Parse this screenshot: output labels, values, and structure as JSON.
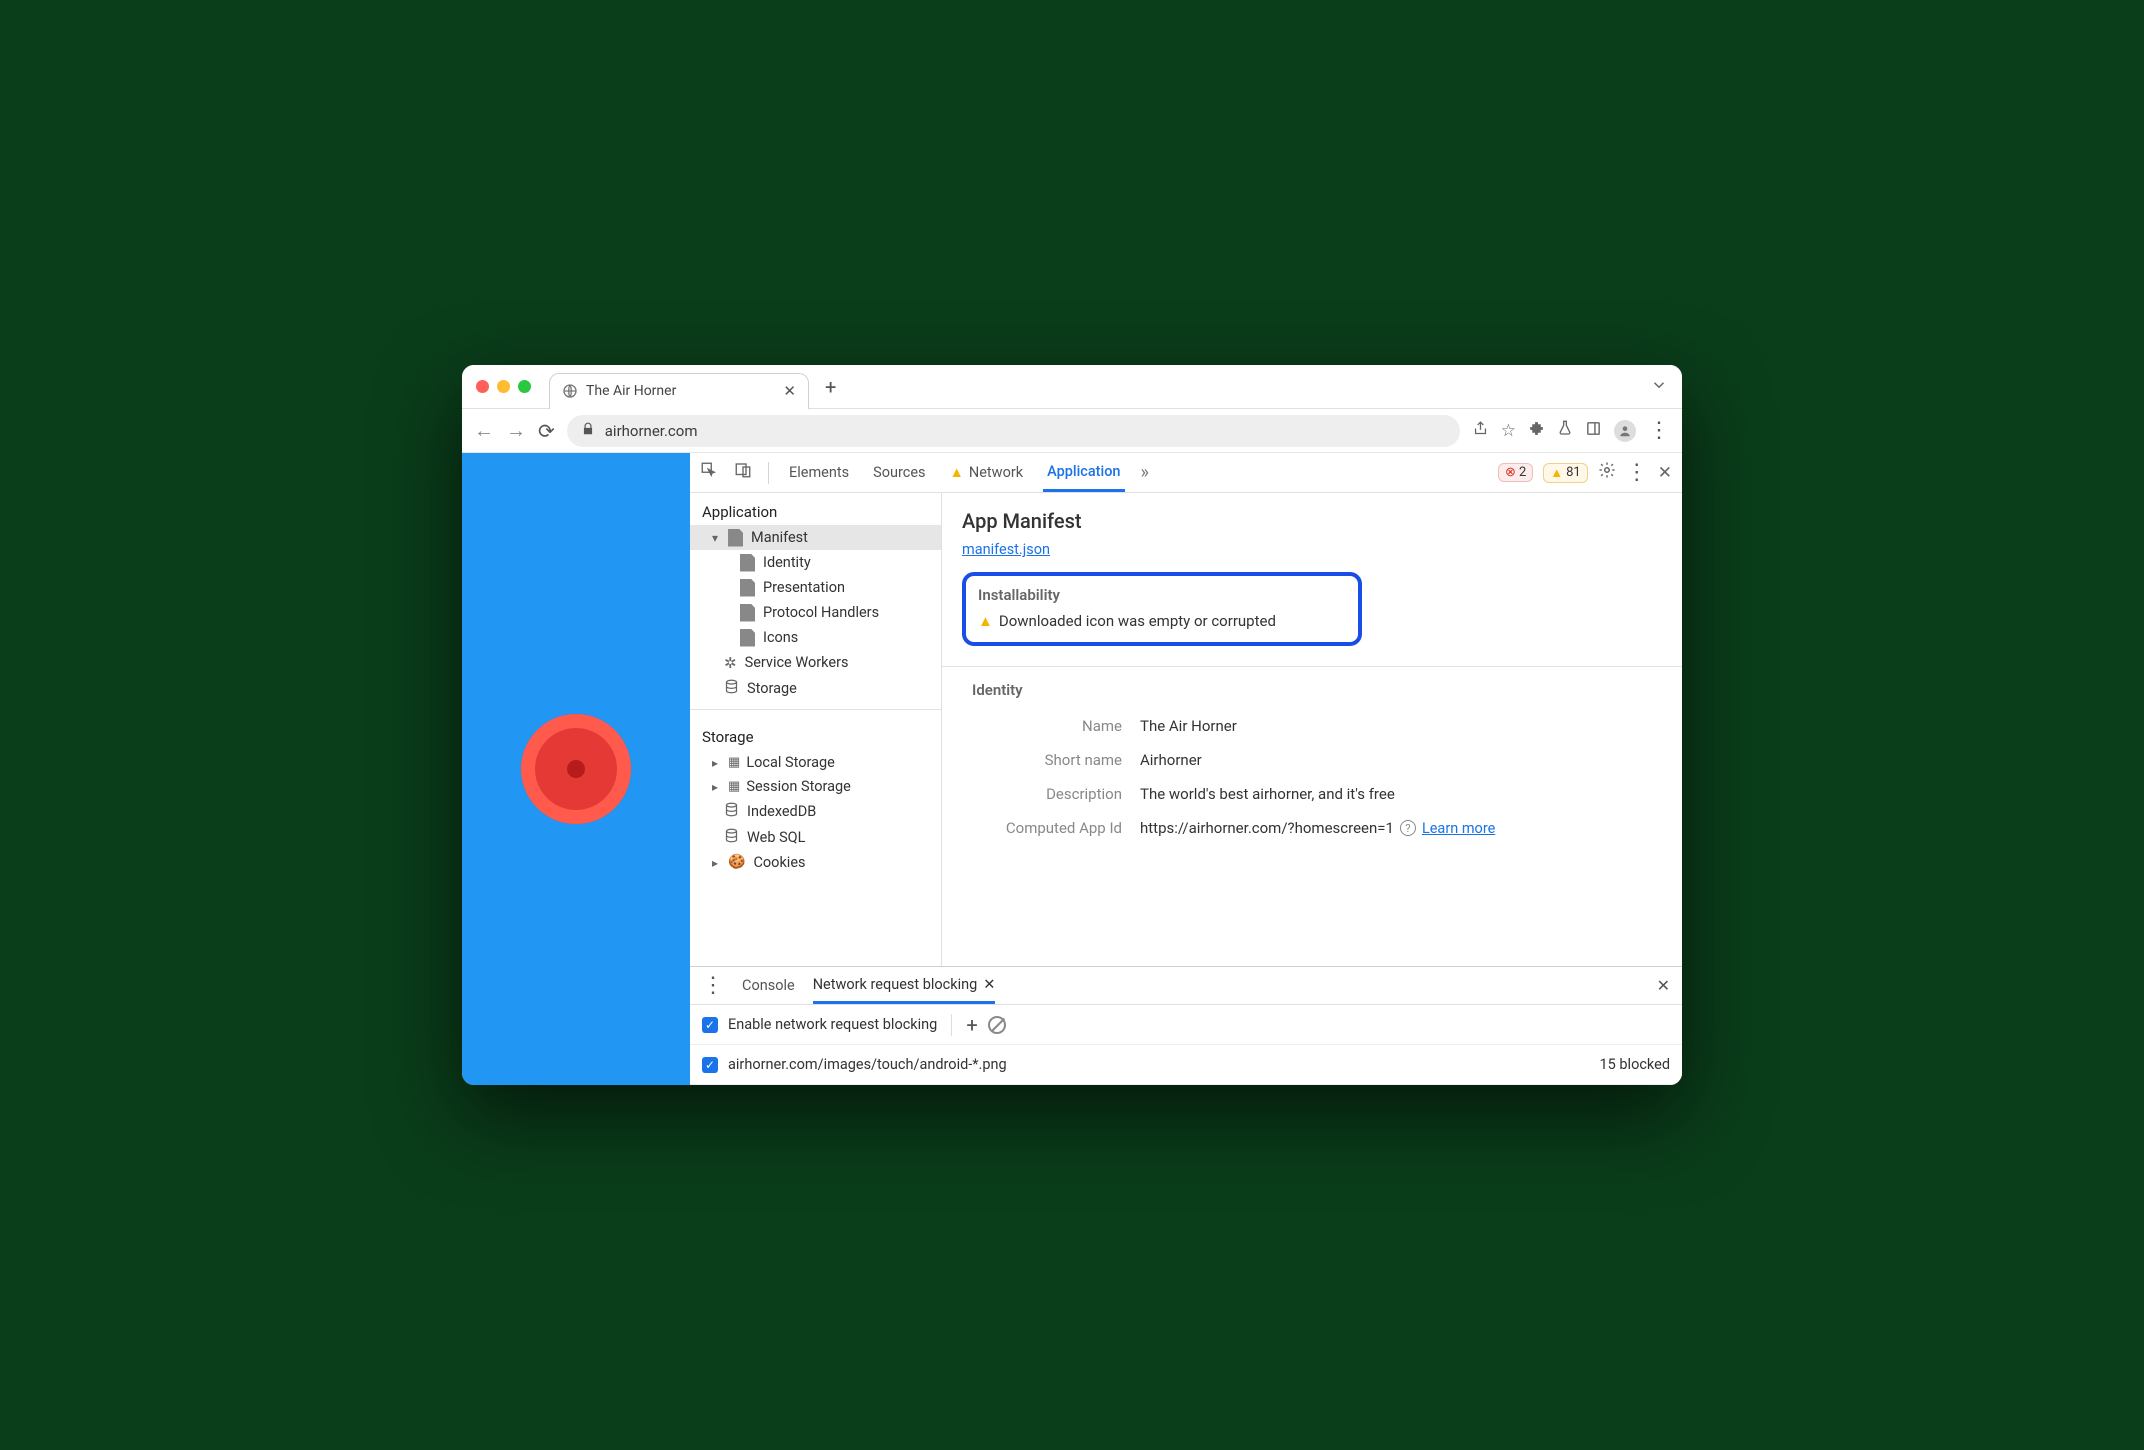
{
  "tab": {
    "title": "The Air Horner"
  },
  "address": "airhorner.com",
  "devtools": {
    "tabs": {
      "elements": "Elements",
      "sources": "Sources",
      "network": "Network",
      "application": "Application"
    },
    "errors": "2",
    "warnings": "81"
  },
  "sidebar": {
    "app_section": "Application",
    "manifest": "Manifest",
    "identity": "Identity",
    "presentation": "Presentation",
    "protocol": "Protocol Handlers",
    "icons": "Icons",
    "service_workers": "Service Workers",
    "storage": "Storage",
    "storage_section": "Storage",
    "local": "Local Storage",
    "session": "Session Storage",
    "indexed": "IndexedDB",
    "websql": "Web SQL",
    "cookies": "Cookies"
  },
  "manifest": {
    "title": "App Manifest",
    "link": "manifest.json",
    "install_title": "Installability",
    "install_msg": "Downloaded icon was empty or corrupted",
    "identity_title": "Identity",
    "fields": {
      "name_label": "Name",
      "name_value": "The Air Horner",
      "short_label": "Short name",
      "short_value": "Airhorner",
      "desc_label": "Description",
      "desc_value": "The world's best airhorner, and it's free",
      "appid_label": "Computed App Id",
      "appid_value": "https://airhorner.com/?homescreen=1",
      "learn_more": "Learn more"
    }
  },
  "drawer": {
    "console": "Console",
    "nrb": "Network request blocking",
    "enable": "Enable network request blocking",
    "pattern": "airhorner.com/images/touch/android-*.png",
    "blocked": "15 blocked"
  }
}
